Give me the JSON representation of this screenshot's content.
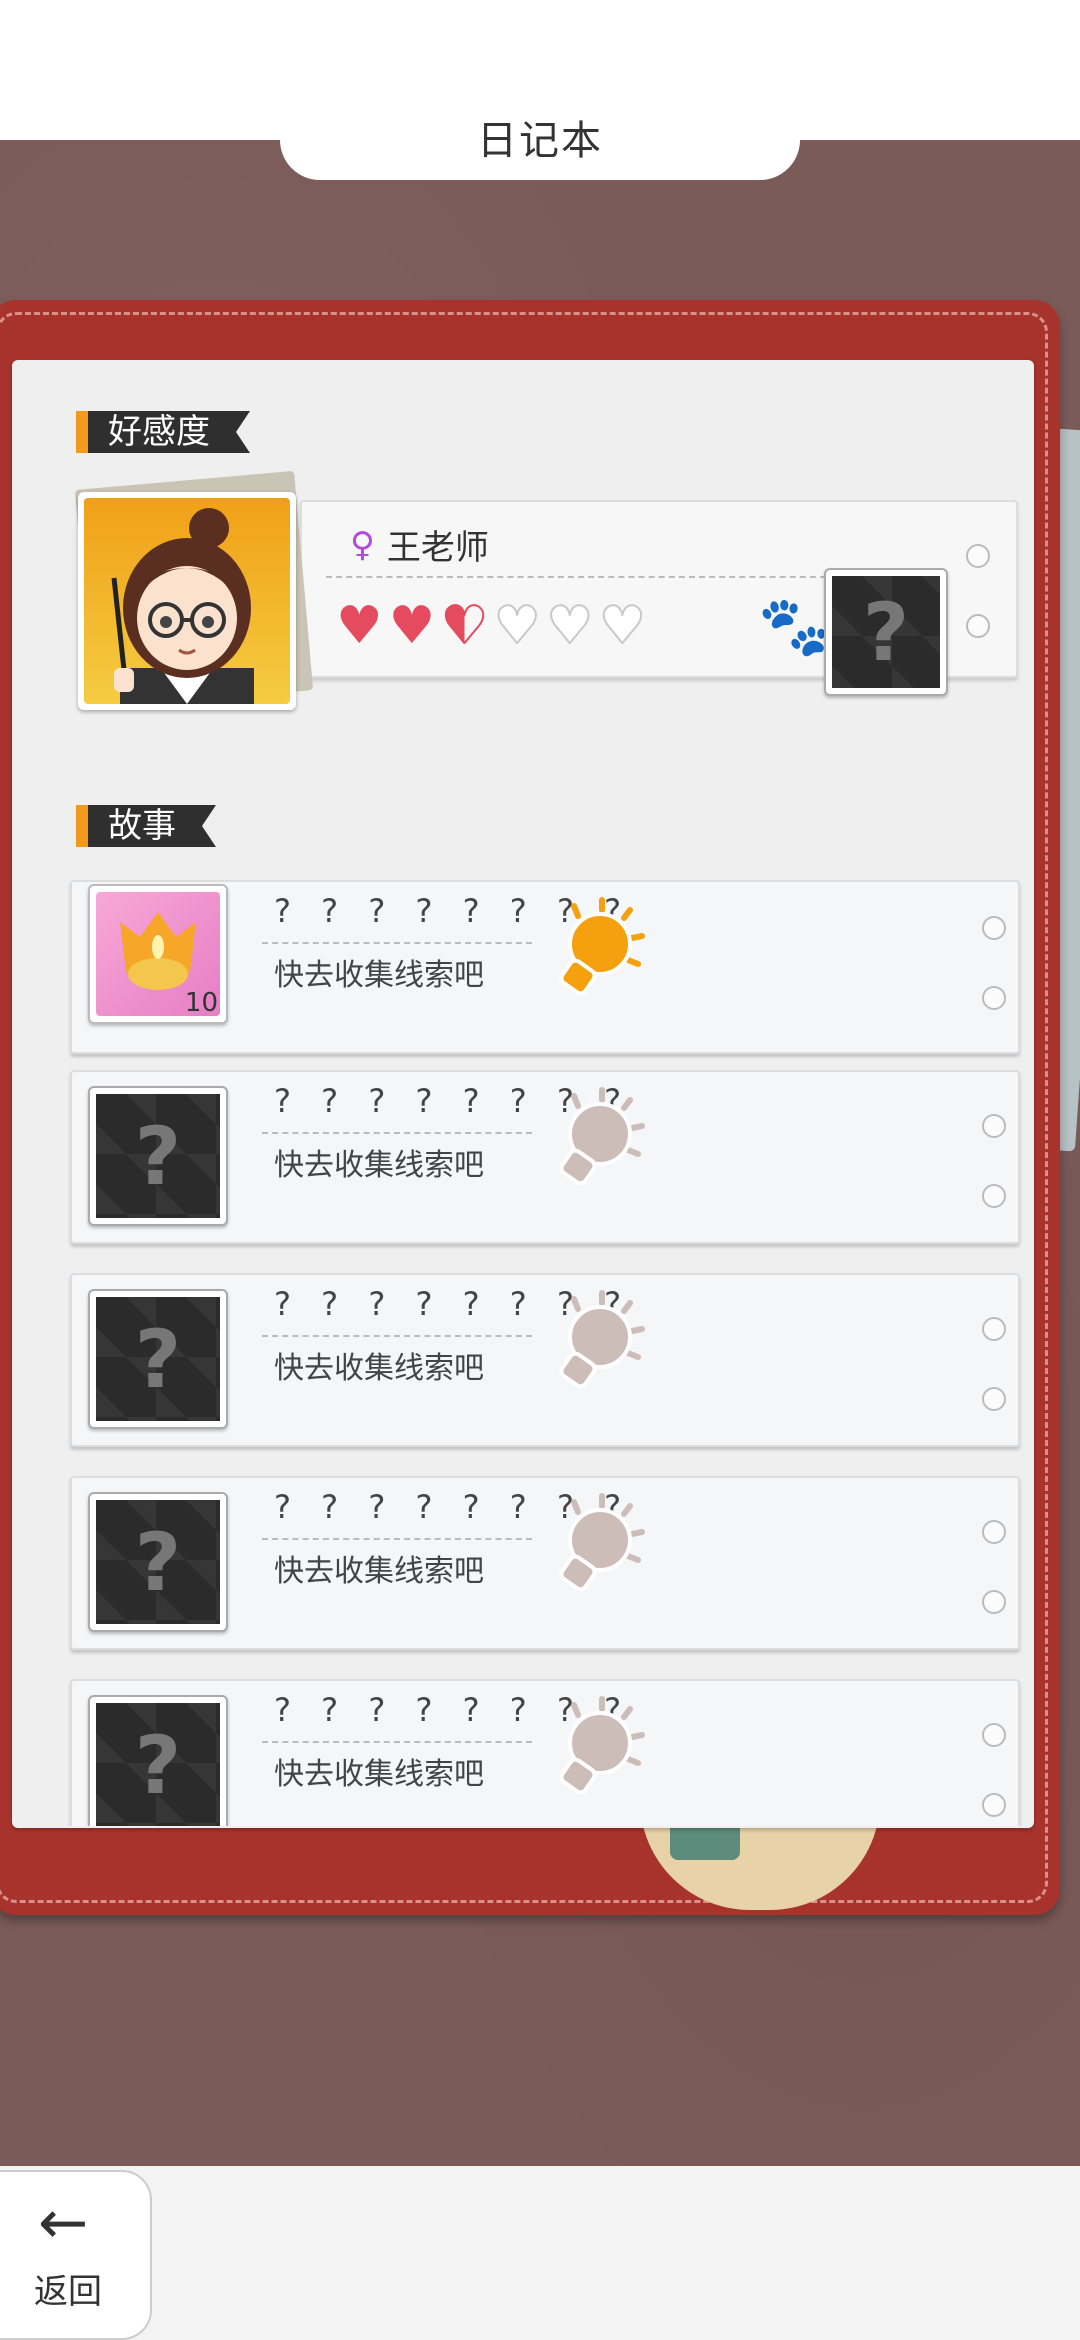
{
  "header": {
    "title": "日记本"
  },
  "affection": {
    "section_label": "好感度",
    "character_name": "王老师",
    "gender_symbol": "♀",
    "hearts_filled": 2.5,
    "hearts_total": 6,
    "mystery_symbol": "?"
  },
  "story": {
    "section_label": "故事",
    "items": [
      {
        "title": "? ? ? ? ? ? ? ?",
        "hint": "快去收集线索吧",
        "unlocked": true,
        "count": "10",
        "bulb": "lit"
      },
      {
        "title": "? ? ? ? ? ? ? ?",
        "hint": "快去收集线索吧",
        "unlocked": false,
        "bulb": "unlit"
      },
      {
        "title": "? ? ? ? ? ? ? ?",
        "hint": "快去收集线索吧",
        "unlocked": false,
        "bulb": "unlit"
      },
      {
        "title": "? ? ? ? ? ? ? ?",
        "hint": "快去收集线索吧",
        "unlocked": false,
        "bulb": "unlit"
      },
      {
        "title": "? ? ? ? ? ? ? ?",
        "hint": "快去收集线索吧",
        "unlocked": false,
        "bulb": "unlit"
      }
    ]
  },
  "footer": {
    "back_label": "返回",
    "back_icon": "←"
  },
  "colors": {
    "accent": "#f39a1c",
    "binder": "#a8332d",
    "heart": "#e44b5f",
    "bulb_lit": "#f5a00f",
    "bulb_unlit": "#cdbdb9"
  }
}
